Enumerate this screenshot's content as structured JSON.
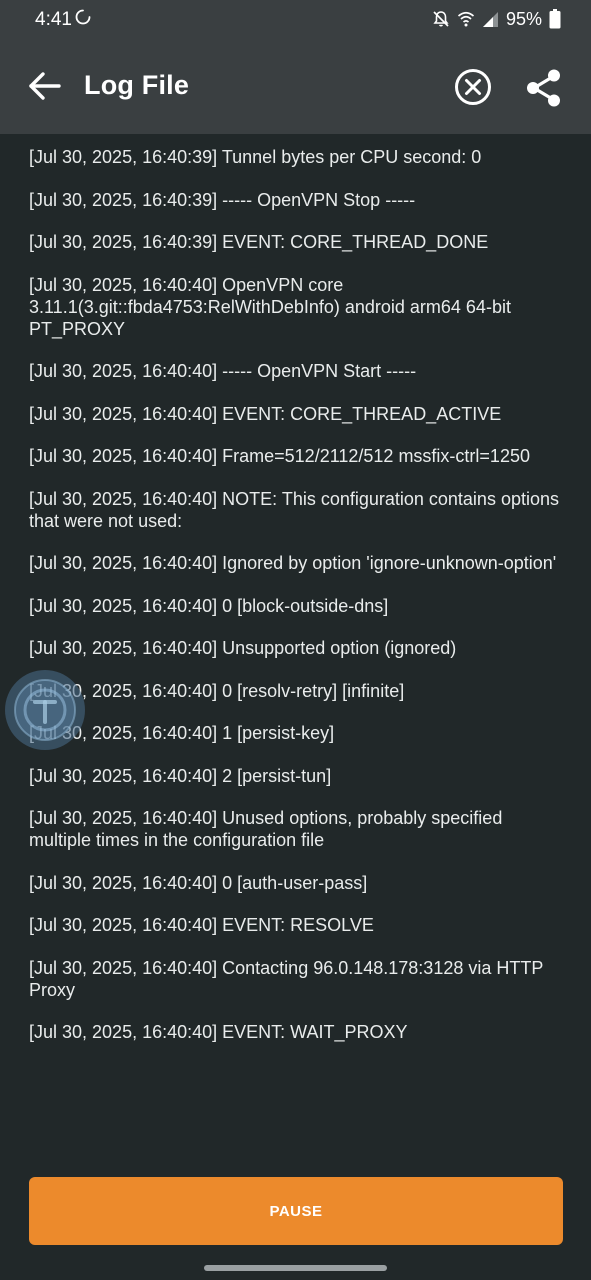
{
  "status_bar": {
    "time": "4:41",
    "battery_percent": "95%",
    "icons": [
      "sync-icon",
      "bell-off-icon",
      "wifi-icon",
      "cell-signal-icon",
      "battery-icon"
    ]
  },
  "app_bar": {
    "title": "Log File",
    "icons": {
      "back": "arrow-back-icon",
      "clear": "circle-x-icon",
      "share": "share-icon"
    }
  },
  "log": {
    "entries": [
      "[Jul 30, 2025, 16:40:39] Tunnel bytes per CPU second: 0",
      "[Jul 30, 2025, 16:40:39] ----- OpenVPN Stop -----",
      "[Jul 30, 2025, 16:40:39] EVENT: CORE_THREAD_DONE",
      "[Jul 30, 2025, 16:40:40] OpenVPN core 3.11.1(3.git::fbda4753:RelWithDebInfo) android arm64 64-bit PT_PROXY",
      "[Jul 30, 2025, 16:40:40] ----- OpenVPN Start -----",
      "[Jul 30, 2025, 16:40:40] EVENT: CORE_THREAD_ACTIVE",
      "[Jul 30, 2025, 16:40:40] Frame=512/2112/512 mssfix-ctrl=1250",
      "[Jul 30, 2025, 16:40:40] NOTE: This configuration contains options that were not used:",
      "[Jul 30, 2025, 16:40:40] Ignored by option 'ignore-unknown-option'",
      "[Jul 30, 2025, 16:40:40] 0 [block-outside-dns]",
      "[Jul 30, 2025, 16:40:40] Unsupported option (ignored)",
      "[Jul 30, 2025, 16:40:40] 0 [resolv-retry] [infinite]",
      "[Jul 30, 2025, 16:40:40] 1 [persist-key]",
      "[Jul 30, 2025, 16:40:40] 2 [persist-tun]",
      "[Jul 30, 2025, 16:40:40] Unused options, probably specified multiple times in the configuration file",
      "[Jul 30, 2025, 16:40:40] 0 [auth-user-pass]",
      "[Jul 30, 2025, 16:40:40] EVENT: RESOLVE",
      "[Jul 30, 2025, 16:40:40] Contacting 96.0.148.178:3128 via HTTP Proxy",
      "[Jul 30, 2025, 16:40:40] EVENT: WAIT_PROXY"
    ]
  },
  "footer": {
    "pause_label": "PAUSE"
  },
  "colors": {
    "background": "#212829",
    "app_bar": "#3a3f41",
    "accent": "#ec8a2c",
    "text": "#e9ecec"
  }
}
